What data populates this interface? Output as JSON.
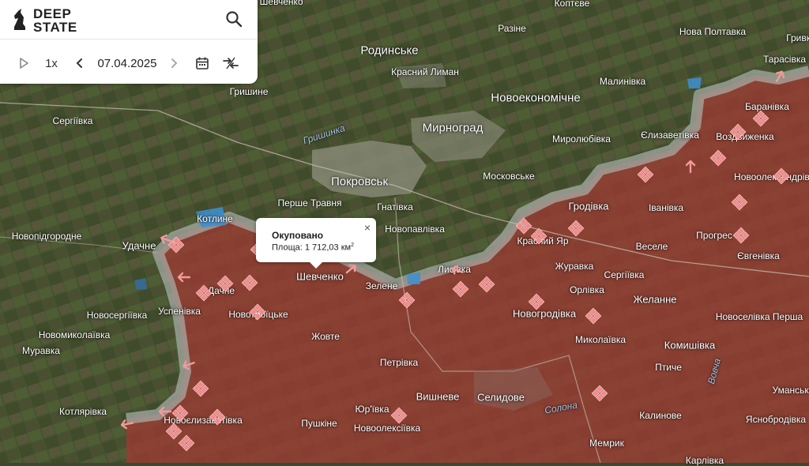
{
  "app": {
    "brand_line1": "DEEP",
    "brand_line2": "STATE",
    "speed": "1x",
    "date": "07.04.2025"
  },
  "popup": {
    "title": "Окуповано",
    "area_text": "Площа: 1 712,03 км",
    "area_sup": "2",
    "close_glyph": "×"
  },
  "colors": {
    "occupied": "#9b3b33",
    "gray_zone": "#a9b2ad",
    "marker": "#f28b8b",
    "water": "#3d8fd1"
  },
  "places": [
    {
      "id": "shevchenko-top",
      "name": "Шевченко"
    },
    {
      "id": "koptieve",
      "name": "Коптєве"
    },
    {
      "id": "razine",
      "name": "Разіне"
    },
    {
      "id": "nova-poltavka",
      "name": "Нова Полтавка"
    },
    {
      "id": "hrivka",
      "name": "Гривка"
    },
    {
      "id": "rodynske",
      "name": "Родинське"
    },
    {
      "id": "tarasivka",
      "name": "Тарасівка"
    },
    {
      "id": "krasnyi-lyman",
      "name": "Красний Лиман"
    },
    {
      "id": "malynivka",
      "name": "Малинівка"
    },
    {
      "id": "hryshyne",
      "name": "Гришине"
    },
    {
      "id": "novoekonomichne",
      "name": "Новоекономічне"
    },
    {
      "id": "baranivka",
      "name": "Баранівка"
    },
    {
      "id": "serhiivka",
      "name": "Сергіївка"
    },
    {
      "id": "myrnohrad",
      "name": "Мирноград"
    },
    {
      "id": "myroliubivka",
      "name": "Миролюбівка"
    },
    {
      "id": "yelyzavetivka",
      "name": "Єлизаветівка"
    },
    {
      "id": "vozdvyzhenka",
      "name": "Воздвиженка"
    },
    {
      "id": "moskovske",
      "name": "Московське"
    },
    {
      "id": "novooleksandrivka",
      "name": "Новоолександрівка"
    },
    {
      "id": "pokrovsk",
      "name": "Покровськ"
    },
    {
      "id": "pershe-travnia",
      "name": "Перше Травня"
    },
    {
      "id": "hnativka",
      "name": "Гнатівка"
    },
    {
      "id": "hrodivka",
      "name": "Гродівка"
    },
    {
      "id": "kotlyne",
      "name": "Котлине"
    },
    {
      "id": "ivanivka",
      "name": "Іванівка"
    },
    {
      "id": "novopavlivka",
      "name": "Новопавлівка"
    },
    {
      "id": "novopidhorodne",
      "name": "Новопідгородне"
    },
    {
      "id": "udachne",
      "name": "Удачне"
    },
    {
      "id": "krasnyi-iar",
      "name": "Красний Яр"
    },
    {
      "id": "veselе",
      "name": "Веселе"
    },
    {
      "id": "progres",
      "name": "Прогрес"
    },
    {
      "id": "yevhenivka",
      "name": "Євгенівка"
    },
    {
      "id": "shevchenko",
      "name": "Шевченко"
    },
    {
      "id": "lysivka",
      "name": "Лисівка"
    },
    {
      "id": "zhuravka",
      "name": "Журавка"
    },
    {
      "id": "serhiivka2",
      "name": "Сергіївка"
    },
    {
      "id": "zelene",
      "name": "Зелене"
    },
    {
      "id": "dachenske",
      "name": "Дачне"
    },
    {
      "id": "orlivka",
      "name": "Орлівка"
    },
    {
      "id": "zhelanne",
      "name": "Желанне"
    },
    {
      "id": "novoserhiivka",
      "name": "Новосергіївка"
    },
    {
      "id": "uspenivka",
      "name": "Успенівка"
    },
    {
      "id": "novotroitske",
      "name": "Новотроїцьке"
    },
    {
      "id": "novohrodivka",
      "name": "Новогродівка"
    },
    {
      "id": "novoselivka-persha",
      "name": "Новоселівка Перша"
    },
    {
      "id": "novomykolaivka",
      "name": "Новомиколаївка"
    },
    {
      "id": "zhovte",
      "name": "Жовте"
    },
    {
      "id": "mykolaivka",
      "name": "Миколаївка"
    },
    {
      "id": "komyshivka",
      "name": "Комишівка"
    },
    {
      "id": "muravka",
      "name": "Муравка"
    },
    {
      "id": "petrivka",
      "name": "Петрівка"
    },
    {
      "id": "ptyche",
      "name": "Птиче"
    },
    {
      "id": "umanske",
      "name": "Уманське"
    },
    {
      "id": "vyshneve",
      "name": "Вишневе"
    },
    {
      "id": "selydove",
      "name": "Селидове"
    },
    {
      "id": "kotliarivka",
      "name": "Котлярівка"
    },
    {
      "id": "yurivka",
      "name": "Юр'ївка"
    },
    {
      "id": "kalynove",
      "name": "Калинове"
    },
    {
      "id": "novoelyzavetivka",
      "name": "Новоєлизаветівка"
    },
    {
      "id": "yasnobrodivka",
      "name": "Яснобродівка"
    },
    {
      "id": "pushkine",
      "name": "Пушкіне"
    },
    {
      "id": "novooleksiivka",
      "name": "Новоолексіївка"
    },
    {
      "id": "memryk",
      "name": "Мемрик"
    },
    {
      "id": "karlivka",
      "name": "Карлівка"
    }
  ],
  "rivers": [
    {
      "id": "hryshynka",
      "name": "Гришинка"
    },
    {
      "id": "solona",
      "name": "Солона"
    },
    {
      "id": "vovcha",
      "name": "Вовча"
    }
  ]
}
